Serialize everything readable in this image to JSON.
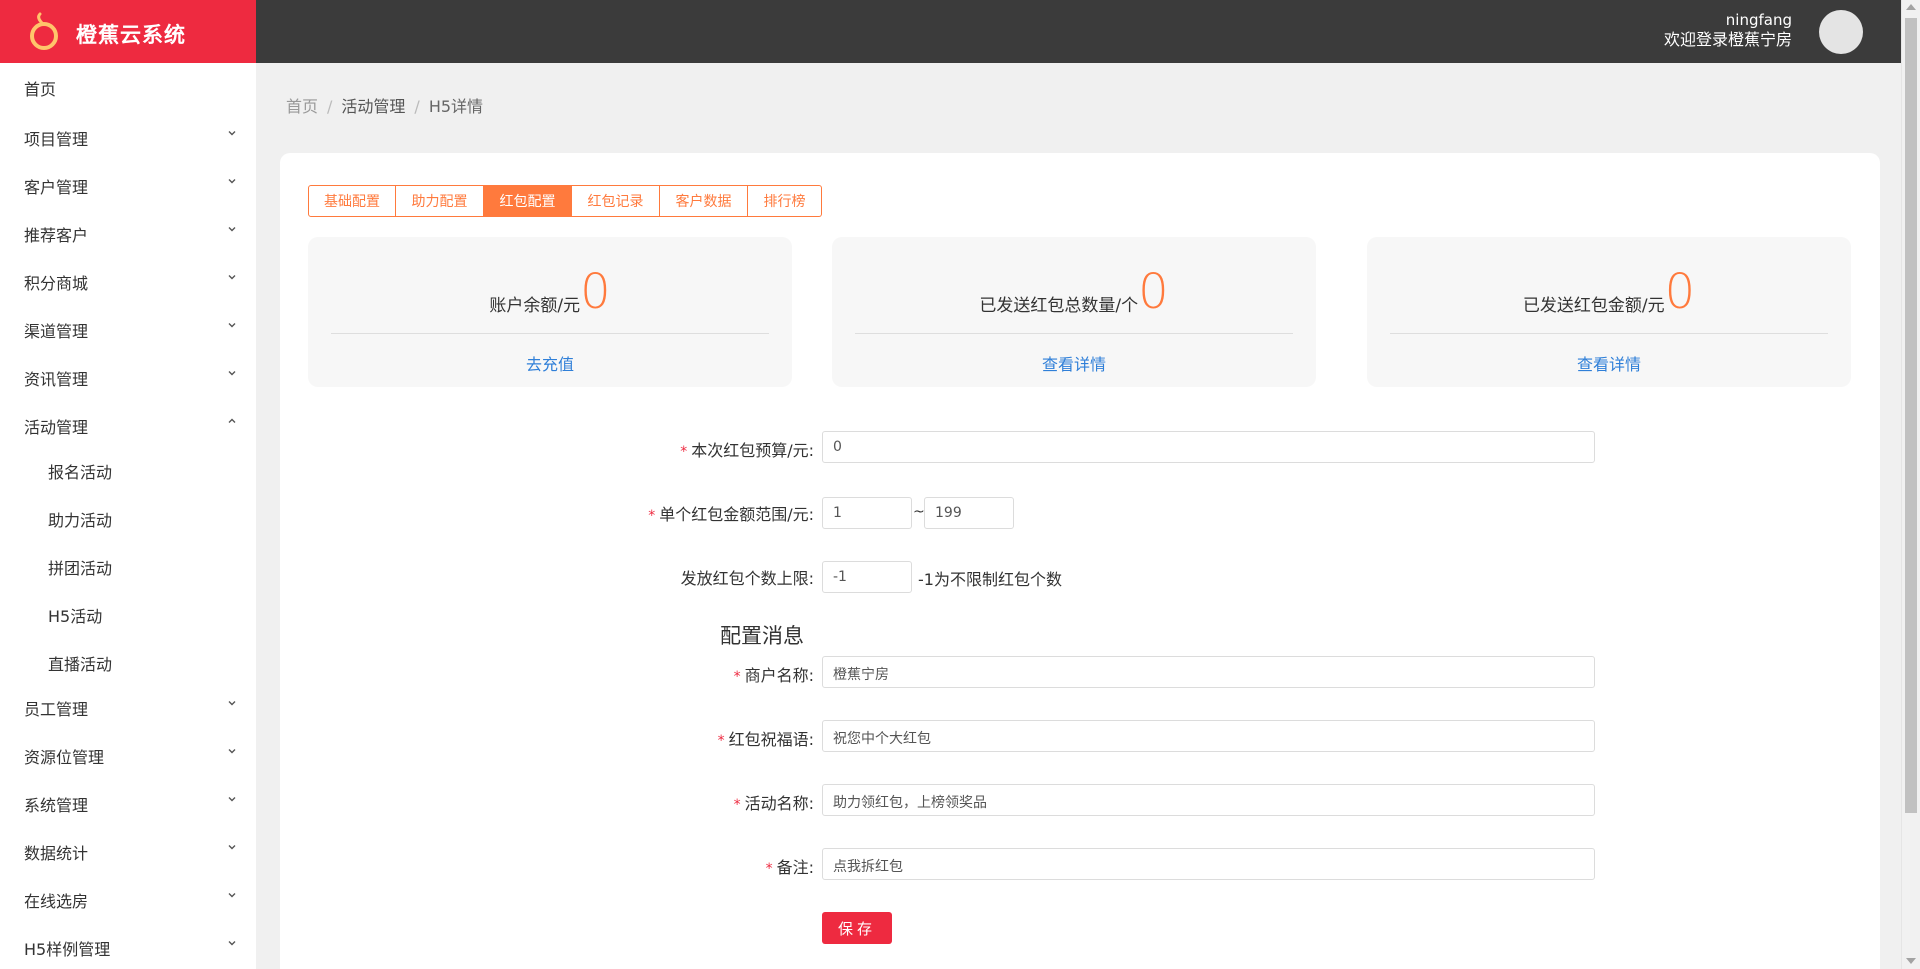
{
  "app": {
    "name": "橙蕉云系统",
    "brand_color": "#ee2a40",
    "accent_color": "#ff7a3d",
    "link_color": "#2f7fd8"
  },
  "user": {
    "name": "ningfang",
    "welcome": "欢迎登录橙蕉宁房"
  },
  "sidebar": {
    "items": [
      {
        "label": "首页",
        "icon": "none"
      },
      {
        "label": "项目管理",
        "icon": "chevron-down-icon"
      },
      {
        "label": "客户管理",
        "icon": "chevron-down-icon"
      },
      {
        "label": "推荐客户",
        "icon": "chevron-down-icon"
      },
      {
        "label": "积分商城",
        "icon": "chevron-down-icon"
      },
      {
        "label": "渠道管理",
        "icon": "chevron-down-icon"
      },
      {
        "label": "资讯管理",
        "icon": "chevron-down-icon"
      },
      {
        "label": "活动管理",
        "icon": "chevron-up-icon"
      },
      {
        "label": "员工管理",
        "icon": "chevron-down-icon"
      },
      {
        "label": "资源位管理",
        "icon": "chevron-down-icon"
      },
      {
        "label": "系统管理",
        "icon": "chevron-down-icon"
      },
      {
        "label": "数据统计",
        "icon": "chevron-down-icon"
      },
      {
        "label": "在线选房",
        "icon": "chevron-down-icon"
      },
      {
        "label": "H5样例管理",
        "icon": "chevron-down-icon"
      }
    ],
    "sub_items": [
      {
        "label": "报名活动"
      },
      {
        "label": "助力活动"
      },
      {
        "label": "拼团活动"
      },
      {
        "label": "H5活动"
      },
      {
        "label": "直播活动"
      }
    ]
  },
  "breadcrumb": {
    "home": "首页",
    "sep": "/",
    "section": "活动管理",
    "current": "H5详情"
  },
  "tabs": [
    {
      "label": "基础配置",
      "active": false
    },
    {
      "label": "助力配置",
      "active": false
    },
    {
      "label": "红包配置",
      "active": true
    },
    {
      "label": "红包记录",
      "active": false
    },
    {
      "label": "客户数据",
      "active": false
    },
    {
      "label": "排行榜",
      "active": false
    }
  ],
  "stats": [
    {
      "label": "账户余额/元",
      "value": "0",
      "link": "去充值"
    },
    {
      "label": "已发送红包总数量/个",
      "value": "0",
      "link": "查看详情"
    },
    {
      "label": "已发送红包金额/元",
      "value": "0",
      "link": "查看详情"
    }
  ],
  "form": {
    "budget": {
      "required_mark": "*",
      "label": "本次红包预算/元:",
      "value": "0"
    },
    "range": {
      "required_mark": "*",
      "label": "单个红包金额范围/元:",
      "min": "1",
      "tilde": "~",
      "max": "199"
    },
    "limit": {
      "label": "发放红包个数上限:",
      "value": "-1",
      "hint": "-1为不限制红包个数"
    },
    "section_title": "配置消息",
    "merchant": {
      "required_mark": "*",
      "label": "商户名称:",
      "value": "橙蕉宁房"
    },
    "blessing": {
      "required_mark": "*",
      "label": "红包祝福语:",
      "value": "祝您中个大红包"
    },
    "activity": {
      "required_mark": "*",
      "label": "活动名称:",
      "value": "助力领红包，上榜领奖品"
    },
    "remark": {
      "required_mark": "*",
      "label": "备注:",
      "value": "点我拆红包"
    },
    "save_label": "保存"
  }
}
